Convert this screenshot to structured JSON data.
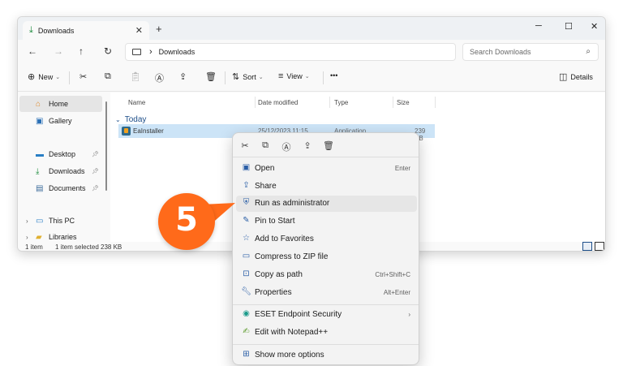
{
  "window": {
    "tab_title": "Downloads",
    "close_tab": "✕",
    "new_tab": "+",
    "minimize": "─",
    "maximize": "☐",
    "close": "✕"
  },
  "address": {
    "back": "←",
    "forward": "→",
    "up": "↑",
    "refresh": "↻",
    "path": "Downloads",
    "separator": "›",
    "search_placeholder": "Search Downloads"
  },
  "toolbar": {
    "new_label": "New",
    "sort_label": "Sort",
    "view_label": "View",
    "more_label": "•••",
    "details_label": "Details"
  },
  "sidebar": {
    "items": [
      {
        "label": "Home",
        "icon": "home-icon",
        "selected": true
      },
      {
        "label": "Gallery",
        "icon": "gallery-icon"
      },
      {
        "label": "Desktop",
        "icon": "desktop-icon",
        "pinned": true
      },
      {
        "label": "Downloads",
        "icon": "download-icon",
        "pinned": true
      },
      {
        "label": "Documents",
        "icon": "documents-icon",
        "pinned": true
      },
      {
        "label": "This PC",
        "icon": "pc-icon"
      },
      {
        "label": "Libraries",
        "icon": "folder-icon"
      }
    ]
  },
  "content": {
    "columns": [
      "Name",
      "Date modified",
      "Type",
      "Size"
    ],
    "group_label": "Today",
    "files": [
      {
        "name": "EaInstaller",
        "date": "25/12/2023 11:15",
        "type": "Application",
        "size": "239 KB"
      }
    ]
  },
  "status": {
    "items_count": "1 item",
    "selection": "1 item selected  238 KB"
  },
  "context_menu": {
    "quick_actions": [
      "cut-icon",
      "copy-icon",
      "rename-icon",
      "share-icon",
      "delete-icon"
    ],
    "items": [
      {
        "label": "Open",
        "shortcut": "Enter",
        "icon": "open-icon"
      },
      {
        "label": "Share",
        "shortcut": "",
        "icon": "share-icon"
      },
      {
        "label": "Run as administrator",
        "shortcut": "",
        "icon": "shield-icon",
        "highlighted": true
      },
      {
        "label": "Pin to Start",
        "shortcut": "",
        "icon": "pin-icon"
      },
      {
        "label": "Add to Favorites",
        "shortcut": "",
        "icon": "star-icon"
      },
      {
        "label": "Compress to ZIP file",
        "shortcut": "",
        "icon": "zip-icon"
      },
      {
        "label": "Copy as path",
        "shortcut": "Ctrl+Shift+C",
        "icon": "path-icon"
      },
      {
        "label": "Properties",
        "shortcut": "Alt+Enter",
        "icon": "wrench-icon"
      },
      {
        "label": "ESET Endpoint Security",
        "shortcut": "›",
        "icon": "eset-icon"
      },
      {
        "label": "Edit with Notepad++",
        "shortcut": "",
        "icon": "notepad-icon"
      },
      {
        "label": "Show more options",
        "shortcut": "",
        "icon": "more-options-icon"
      }
    ]
  },
  "callout": {
    "step_number": "5",
    "color": "#ff6a1a"
  }
}
